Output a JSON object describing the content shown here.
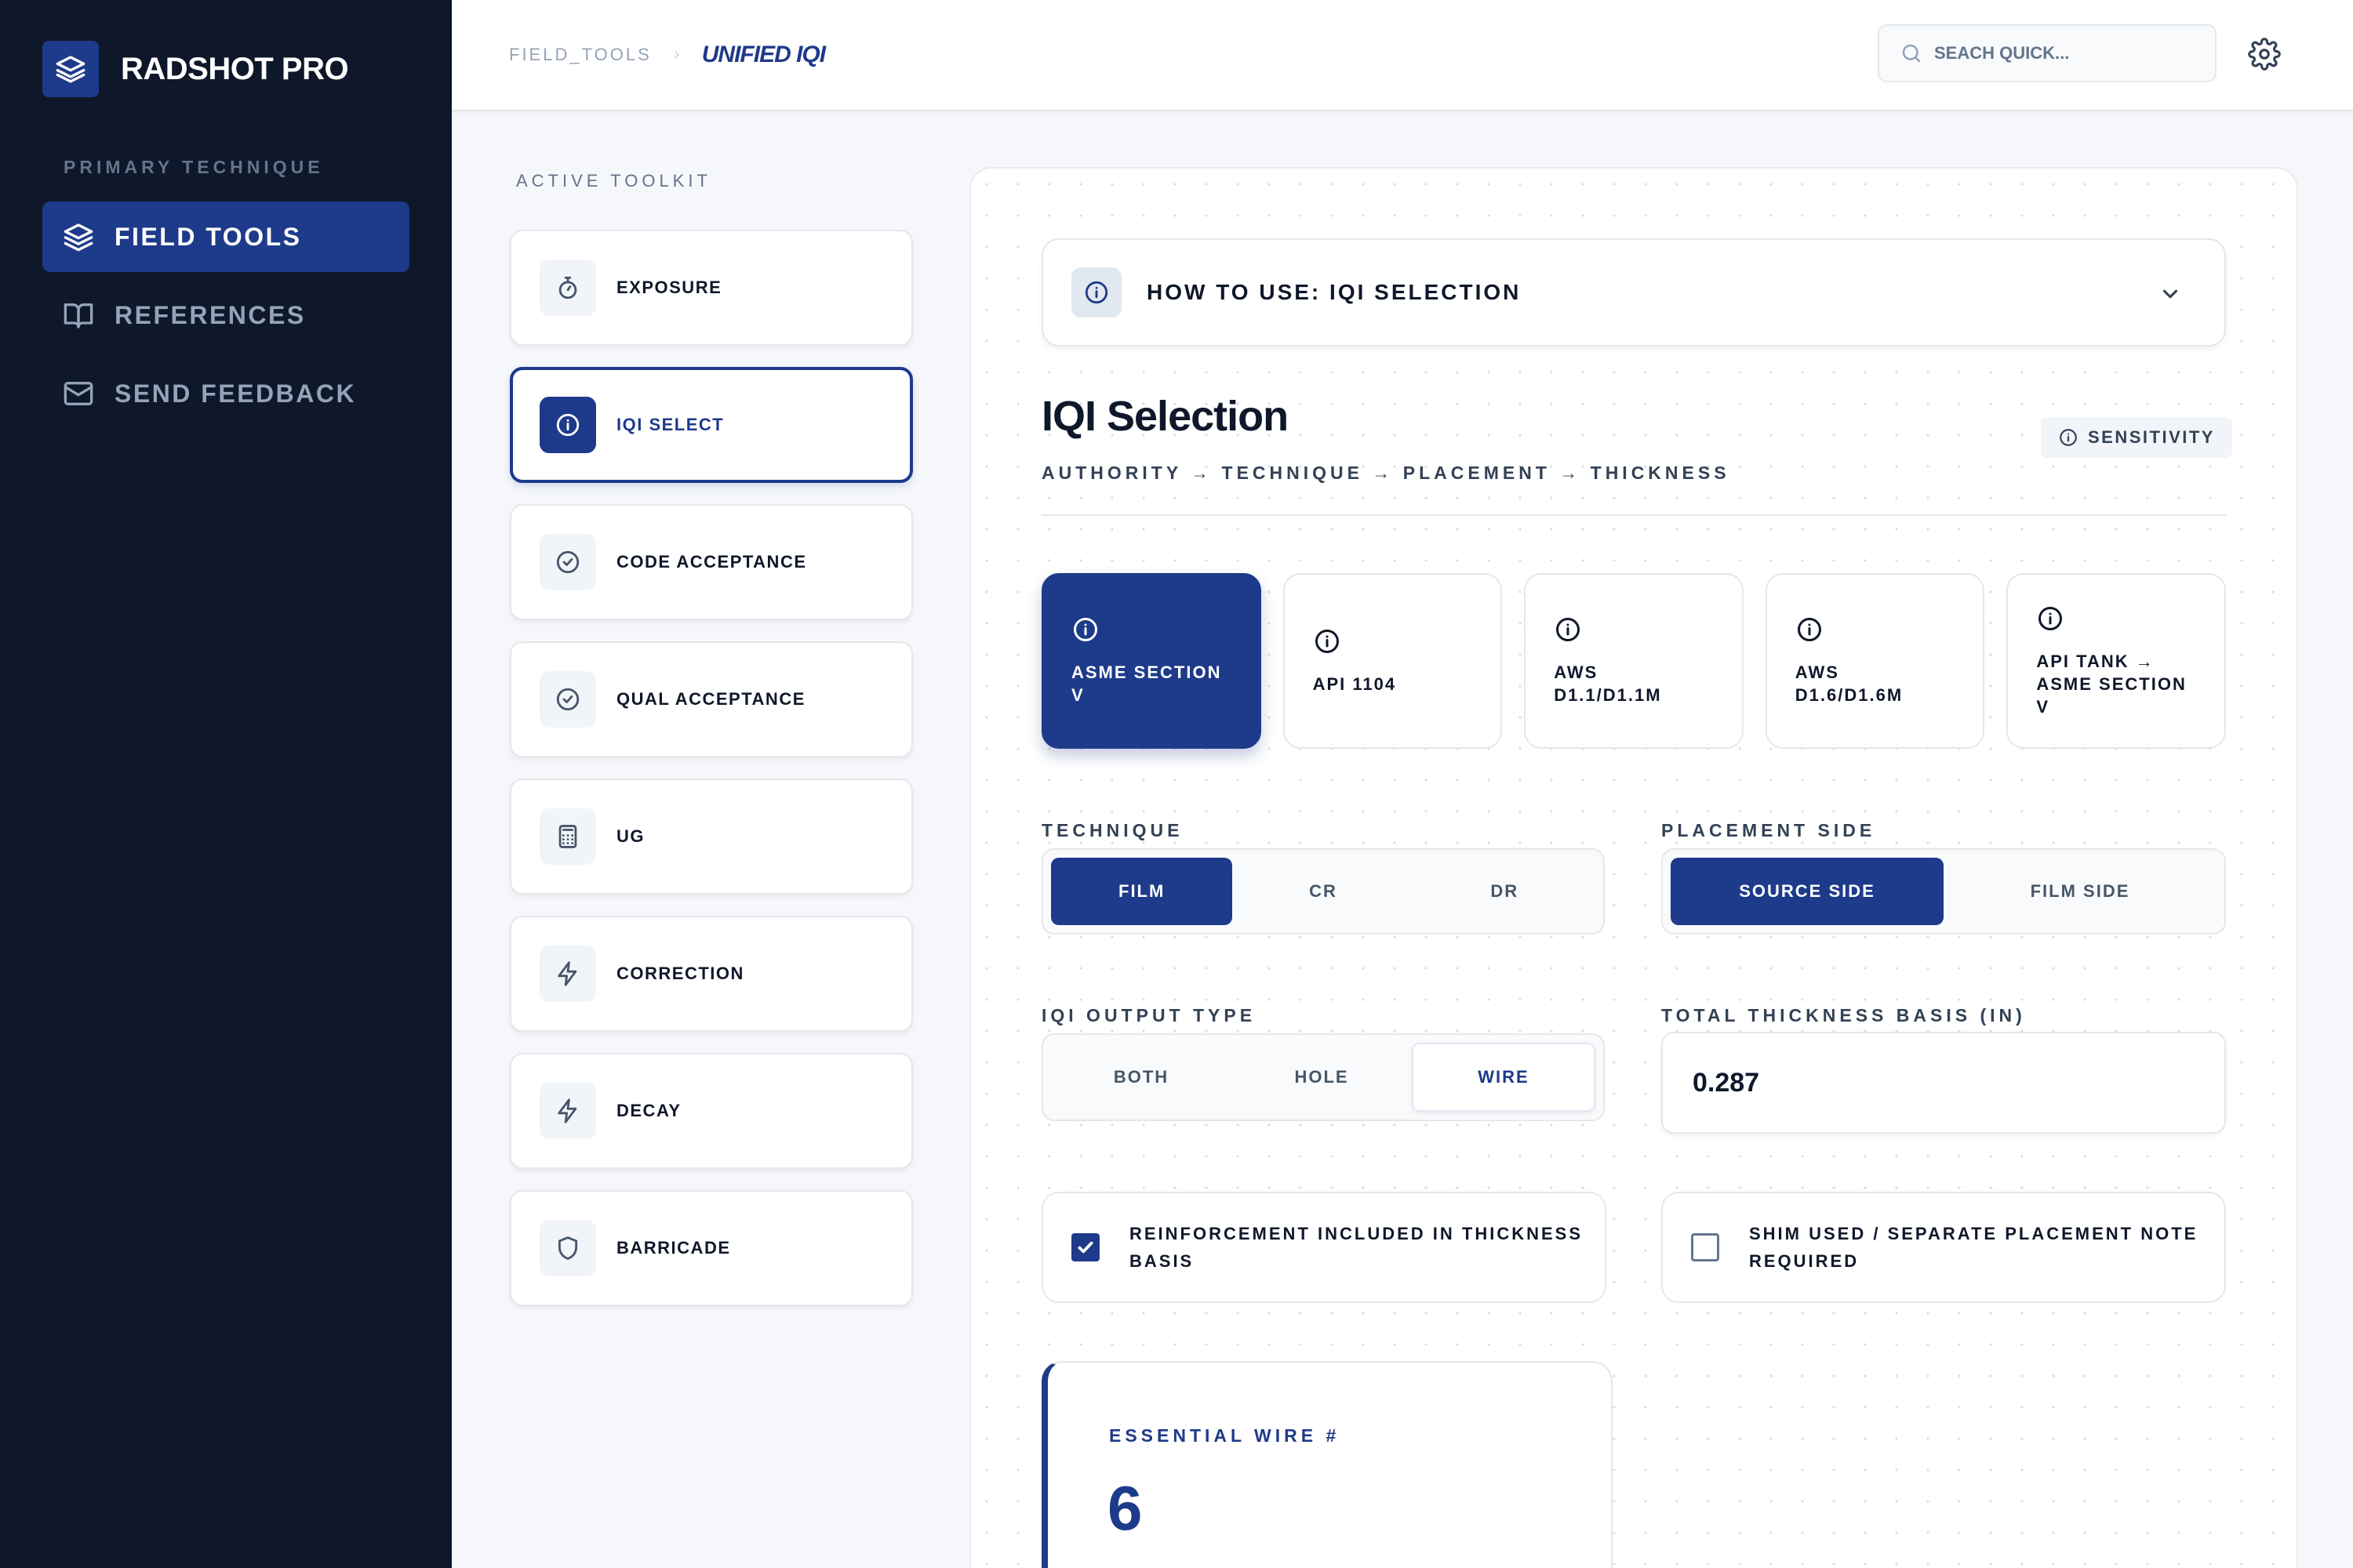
{
  "app": {
    "name": "RADSHOT PRO"
  },
  "sidebar": {
    "section_title": "PRIMARY TECHNIQUE",
    "items": [
      {
        "label": "FIELD TOOLS",
        "icon": "layers-icon",
        "active": true
      },
      {
        "label": "REFERENCES",
        "icon": "book-icon",
        "active": false
      },
      {
        "label": "SEND FEEDBACK",
        "icon": "mail-icon",
        "active": false
      }
    ]
  },
  "header": {
    "breadcrumb_parent": "FIELD_TOOLS",
    "breadcrumb_current": "UNIFIED IQI",
    "search_placeholder": "SEACH QUICK..."
  },
  "toolkit": {
    "title": "ACTIVE TOOLKIT",
    "items": [
      {
        "label": "EXPOSURE",
        "icon": "stopwatch-icon"
      },
      {
        "label": "IQI SELECT",
        "icon": "info-icon",
        "active": true
      },
      {
        "label": "CODE ACCEPTANCE",
        "icon": "check-circle-icon"
      },
      {
        "label": "QUAL ACCEPTANCE",
        "icon": "check-circle-icon"
      },
      {
        "label": "UG",
        "icon": "calculator-icon"
      },
      {
        "label": "CORRECTION",
        "icon": "bolt-icon"
      },
      {
        "label": "DECAY",
        "icon": "bolt-icon"
      },
      {
        "label": "BARRICADE",
        "icon": "shield-icon"
      }
    ]
  },
  "main": {
    "howto_label": "HOW TO USE: IQI SELECTION",
    "title": "IQI Selection",
    "flow": "AUTHORITY → TECHNIQUE → PLACEMENT → THICKNESS",
    "sensitivity_label": "SENSITIVITY",
    "authorities": [
      {
        "label": "ASME SECTION V",
        "active": true
      },
      {
        "label": "API 1104"
      },
      {
        "label": "AWS D1.1/D1.1M"
      },
      {
        "label": "AWS D1.6/D1.6M"
      },
      {
        "label": "API TANK → ASME SECTION V"
      }
    ],
    "technique": {
      "label": "TECHNIQUE",
      "options": [
        "FILM",
        "CR",
        "DR"
      ],
      "selected": "FILM"
    },
    "placement": {
      "label": "PLACEMENT SIDE",
      "options": [
        "SOURCE SIDE",
        "FILM SIDE"
      ],
      "selected": "SOURCE SIDE"
    },
    "output_type": {
      "label": "IQI OUTPUT TYPE",
      "options": [
        "BOTH",
        "HOLE",
        "WIRE"
      ],
      "selected": "WIRE"
    },
    "thickness": {
      "label": "TOTAL THICKNESS BASIS (IN)",
      "value": "0.287"
    },
    "reinforcement": {
      "label": "REINFORCEMENT INCLUDED IN THICKNESS BASIS",
      "checked": true
    },
    "shim": {
      "label": "SHIM USED / SEPARATE PLACEMENT NOTE REQUIRED",
      "checked": false
    },
    "result": {
      "label": "ESSENTIAL WIRE #",
      "value": "6"
    }
  },
  "colors": {
    "primary": "#1e3a8a",
    "sidebar_bg": "#0f172a"
  }
}
